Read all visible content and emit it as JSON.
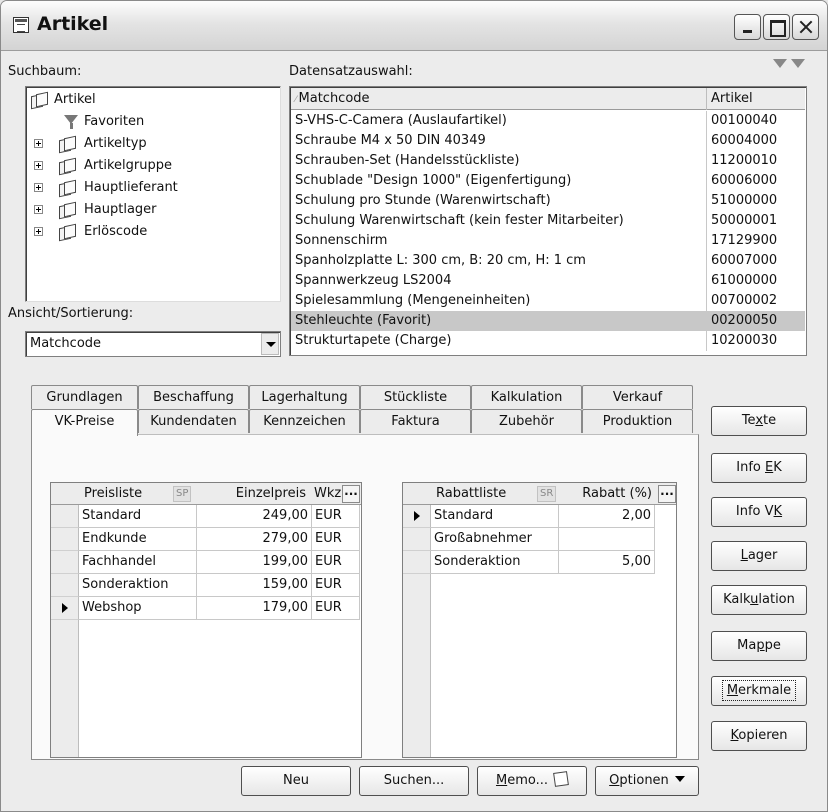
{
  "window": {
    "title": "Artikel"
  },
  "labels": {
    "suchbaum": "Suchbaum:",
    "datensatz": "Datensatzauswahl:",
    "ansicht": "Ansicht/Sortierung:"
  },
  "tree": [
    {
      "label": "Artikel",
      "icon": "folder-icon",
      "expandable": false,
      "level": 0
    },
    {
      "label": "Favoriten",
      "icon": "filter-icon",
      "expandable": false,
      "level": 1
    },
    {
      "label": "Artikeltyp",
      "icon": "folder-icon",
      "expandable": true,
      "level": 1
    },
    {
      "label": "Artikelgruppe",
      "icon": "folder-icon",
      "expandable": true,
      "level": 1
    },
    {
      "label": "Hauptlieferant",
      "icon": "folder-icon",
      "expandable": true,
      "level": 1
    },
    {
      "label": "Hauptlager",
      "icon": "folder-icon",
      "expandable": true,
      "level": 1
    },
    {
      "label": "Erlöscode",
      "icon": "folder-icon",
      "expandable": true,
      "level": 1
    }
  ],
  "sort": {
    "value": "Matchcode"
  },
  "records": {
    "columns": [
      "Matchcode",
      "Artikel"
    ],
    "rows": [
      [
        "S-VHS-C-Camera (Auslaufartikel)",
        "00100040"
      ],
      [
        "Schraube M4 x 50 DIN 40349",
        "60004000"
      ],
      [
        "Schrauben-Set (Handelsstückliste)",
        "11200010"
      ],
      [
        "Schublade \"Design 1000\" (Eigenfertigung)",
        "60006000"
      ],
      [
        "Schulung pro Stunde (Warenwirtschaft)",
        "51000000"
      ],
      [
        "Schulung Warenwirtschaft (kein fester Mitarbeiter)",
        "50000001"
      ],
      [
        "Sonnenschirm",
        "17129900"
      ],
      [
        "Spanholzplatte L: 300 cm, B: 20 cm, H: 1 cm",
        "60007000"
      ],
      [
        "Spannwerkzeug LS2004",
        "61000000"
      ],
      [
        "Spielesammlung (Mengeneinheiten)",
        "00700002"
      ],
      [
        "Stehleuchte  (Favorit)",
        "00200050"
      ],
      [
        "Strukturtapete (Charge)",
        "10200030"
      ]
    ],
    "selected_index": 10
  },
  "tabs_row1": [
    "Grundlagen",
    "Beschaffung",
    "Lagerhaltung",
    "Stückliste",
    "Kalkulation",
    "Verkauf"
  ],
  "tabs_row2": [
    "VK-Preise",
    "Kundendaten",
    "Kennzeichen",
    "Faktura",
    "Zubehör",
    "Produktion"
  ],
  "active_tab": "VK-Preise",
  "prices": {
    "headers": {
      "list": "Preisliste",
      "tag": "SP",
      "price": "Einzelpreis",
      "currency": "Wkz",
      "more": "..."
    },
    "rows": [
      {
        "name": "Standard",
        "price": "249,00",
        "currency": "EUR"
      },
      {
        "name": "Endkunde",
        "price": "279,00",
        "currency": "EUR"
      },
      {
        "name": "Fachhandel",
        "price": "199,00",
        "currency": "EUR"
      },
      {
        "name": "Sonderaktion",
        "price": "159,00",
        "currency": "EUR"
      },
      {
        "name": "Webshop",
        "price": "179,00",
        "currency": "EUR"
      }
    ],
    "current_row": 4
  },
  "discounts": {
    "headers": {
      "list": "Rabattliste",
      "tag": "SR",
      "discount": "Rabatt (%)",
      "more": "..."
    },
    "rows": [
      {
        "name": "Standard",
        "discount": "2,00"
      },
      {
        "name": "Großabnehmer",
        "discount": ""
      },
      {
        "name": "Sonderaktion",
        "discount": "5,00"
      }
    ],
    "current_row": 0
  },
  "side_buttons": [
    {
      "pre": "Te",
      "ul": "x",
      "post": "te"
    },
    {
      "pre": "Info ",
      "ul": "E",
      "post": "K"
    },
    {
      "pre": "Info V",
      "ul": "K",
      "post": ""
    },
    {
      "pre": "",
      "ul": "L",
      "post": "ager"
    },
    {
      "pre": "Kalk",
      "ul": "u",
      "post": "lation"
    },
    {
      "pre": "Ma",
      "ul": "p",
      "post": "pe"
    },
    {
      "pre": "",
      "ul": "M",
      "post": "erkmale"
    },
    {
      "pre": "",
      "ul": "K",
      "post": "opieren"
    }
  ],
  "bottom_buttons": {
    "neu": "Neu",
    "suchen": "Suchen...",
    "memo_ul": "M",
    "memo_rest": "emo...",
    "optionen_ul": "O",
    "optionen_rest": "ptionen"
  }
}
